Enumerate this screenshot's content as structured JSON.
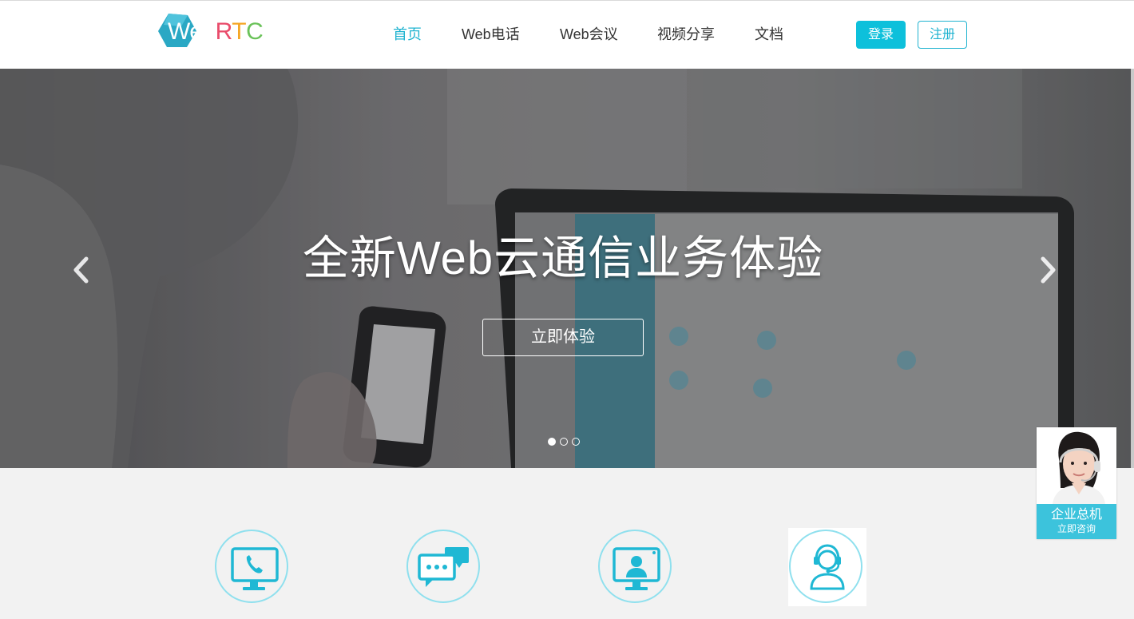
{
  "logo": {
    "web": "Web",
    "r": "R",
    "t": "T",
    "c": "C"
  },
  "nav": {
    "items": [
      {
        "label": "首页",
        "active": true
      },
      {
        "label": "Web电话",
        "active": false
      },
      {
        "label": "Web会议",
        "active": false
      },
      {
        "label": "视频分享",
        "active": false
      },
      {
        "label": "文档",
        "active": false
      }
    ]
  },
  "auth": {
    "login_label": "登录",
    "register_label": "注册"
  },
  "hero": {
    "title": "全新Web云通信业务体验",
    "cta_label": "立即体验",
    "slide_count": 3,
    "active_slide": 1,
    "prev_icon": "chevron-left-icon",
    "next_icon": "chevron-right-icon"
  },
  "features": [
    {
      "icon": "phone-monitor-icon"
    },
    {
      "icon": "chat-bubbles-icon"
    },
    {
      "icon": "user-monitor-icon"
    },
    {
      "icon": "headset-agent-icon"
    }
  ],
  "contact": {
    "title": "企业总机",
    "subtitle": "立即咨询",
    "icon": "customer-service-avatar"
  },
  "colors": {
    "accent": "#1fb3d0",
    "login_bg": "#0dc0db",
    "feature_ring": "#8fe0ee",
    "contact_bg": "#3cc3dc"
  }
}
